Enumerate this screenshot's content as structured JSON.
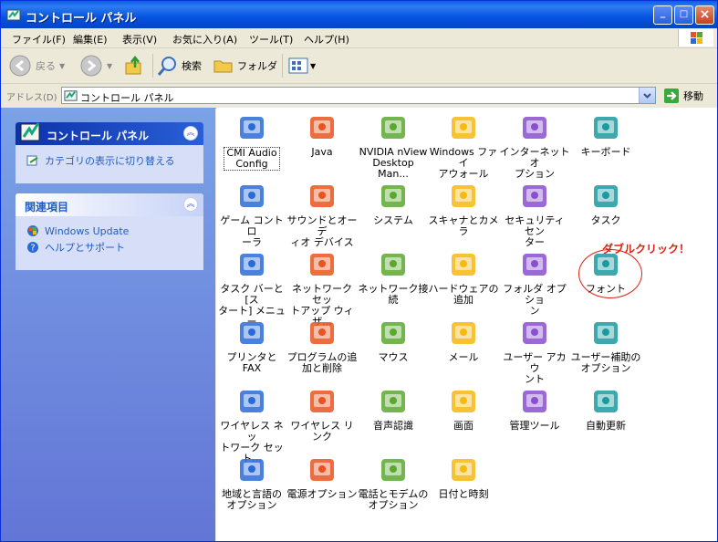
{
  "window": {
    "title": "コントロール パネル",
    "min_label": "_",
    "max_label": "□",
    "close_label": "×"
  },
  "menu": [
    "ファイル(F)",
    "編集(E)",
    "表示(V)",
    "お気に入り(A)",
    "ツール(T)",
    "ヘルプ(H)"
  ],
  "toolbar": {
    "back": "戻る",
    "search": "検索",
    "folders": "フォルダ"
  },
  "address": {
    "label": "アドレス(D)",
    "value": "コントロール パネル",
    "go": "移動"
  },
  "sidebar": {
    "panel1": {
      "title": "コントロール パネル",
      "link": "カテゴリの表示に切り替える"
    },
    "panel2": {
      "title": "関連項目",
      "links": [
        "Windows Update",
        "ヘルプとサポート"
      ]
    }
  },
  "items": [
    {
      "l1": "CMI Audio",
      "l2": "Config",
      "icon": "audio-config-icon"
    },
    {
      "l1": "Java",
      "l2": "",
      "icon": "java-icon"
    },
    {
      "l1": "NVIDIA nView",
      "l2": "Desktop Man...",
      "icon": "nvidia-icon"
    },
    {
      "l1": "Windows ファイ",
      "l2": "アウォール",
      "icon": "firewall-icon"
    },
    {
      "l1": "インターネット オ",
      "l2": "プション",
      "icon": "internet-options-icon"
    },
    {
      "l1": "キーボード",
      "l2": "",
      "icon": "keyboard-icon"
    },
    {
      "l1": "ゲーム コントロ",
      "l2": "ーラ",
      "icon": "game-controller-icon"
    },
    {
      "l1": "サウンドとオーデ",
      "l2": "ィオ デバイス",
      "icon": "speaker-icon"
    },
    {
      "l1": "システム",
      "l2": "",
      "icon": "system-icon"
    },
    {
      "l1": "スキャナとカメラ",
      "l2": "",
      "icon": "scanner-camera-icon"
    },
    {
      "l1": "セキュリティ セン",
      "l2": "ター",
      "icon": "security-shield-icon"
    },
    {
      "l1": "タスク",
      "l2": "",
      "icon": "task-folder-icon"
    },
    {
      "l1": "タスク バーと [ス",
      "l2": "タート] メニュー",
      "icon": "taskbar-icon"
    },
    {
      "l1": "ネットワーク セッ",
      "l2": "トアップ ウィザ...",
      "icon": "network-setup-icon"
    },
    {
      "l1": "ネットワーク接",
      "l2": "続",
      "icon": "network-connection-icon"
    },
    {
      "l1": "ハードウェアの",
      "l2": "追加",
      "icon": "hardware-icon"
    },
    {
      "l1": "フォルダ オプショ",
      "l2": "ン",
      "icon": "folder-options-icon"
    },
    {
      "l1": "フォント",
      "l2": "",
      "icon": "fonts-folder-icon"
    },
    {
      "l1": "プリンタと FAX",
      "l2": "",
      "icon": "printer-icon"
    },
    {
      "l1": "プログラムの追",
      "l2": "加と削除",
      "icon": "add-remove-programs-icon"
    },
    {
      "l1": "マウス",
      "l2": "",
      "icon": "mouse-icon"
    },
    {
      "l1": "メール",
      "l2": "",
      "icon": "mail-icon"
    },
    {
      "l1": "ユーザー アカウ",
      "l2": "ント",
      "icon": "user-accounts-icon"
    },
    {
      "l1": "ユーザー補助の",
      "l2": "オプション",
      "icon": "accessibility-icon"
    },
    {
      "l1": "ワイヤレス ネッ",
      "l2": "トワーク セット...",
      "icon": "wireless-network-icon"
    },
    {
      "l1": "ワイヤレス リンク",
      "l2": "",
      "icon": "wireless-link-icon"
    },
    {
      "l1": "音声認識",
      "l2": "",
      "icon": "speech-icon"
    },
    {
      "l1": "画面",
      "l2": "",
      "icon": "display-icon"
    },
    {
      "l1": "管理ツール",
      "l2": "",
      "icon": "admin-tools-icon"
    },
    {
      "l1": "自動更新",
      "l2": "",
      "icon": "auto-update-icon"
    },
    {
      "l1": "地域と言語の",
      "l2": "オプション",
      "icon": "region-language-icon"
    },
    {
      "l1": "電源オプション",
      "l2": "",
      "icon": "power-options-icon"
    },
    {
      "l1": "電話とモデムの",
      "l2": "オプション",
      "icon": "phone-modem-icon"
    },
    {
      "l1": "日付と時刻",
      "l2": "",
      "icon": "date-time-icon"
    }
  ],
  "annotation": "ダブルクリック！"
}
